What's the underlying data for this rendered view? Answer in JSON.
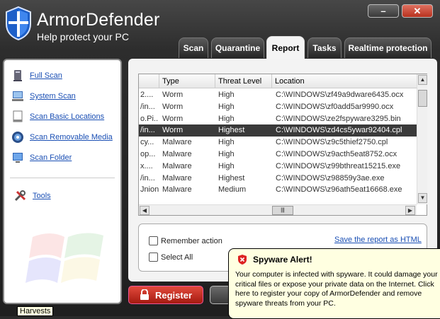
{
  "app": {
    "title": "ArmorDefender",
    "subtitle": "Help protect your PC",
    "minimize_label": "–",
    "close_label": "✕"
  },
  "tabs": [
    {
      "label": "Scan",
      "active": false
    },
    {
      "label": "Quarantine",
      "active": false
    },
    {
      "label": "Report",
      "active": true
    },
    {
      "label": "Tasks",
      "active": false
    },
    {
      "label": "Realtime protection",
      "active": false
    }
  ],
  "sidebar": {
    "items": [
      {
        "label": "Full Scan",
        "icon": "computer-icon"
      },
      {
        "label": "System Scan",
        "icon": "system-icon"
      },
      {
        "label": "Scan Basic Locations",
        "icon": "document-icon"
      },
      {
        "label": "Scan Removable Media",
        "icon": "disc-icon"
      },
      {
        "label": "Scan Folder",
        "icon": "monitor-icon"
      }
    ],
    "tools_label": "Tools"
  },
  "report": {
    "columns": [
      "Type",
      "Threat Level",
      "Location"
    ],
    "rows": [
      {
        "name": "2....",
        "type": "Worm",
        "level": "High",
        "location": "C:\\WINDOWS\\zf49a9dware6435.ocx",
        "selected": false
      },
      {
        "name": "/in...",
        "type": "Worm",
        "level": "High",
        "location": "C:\\WINDOWS\\zf0add5ar9990.ocx",
        "selected": false
      },
      {
        "name": "o.Pi...",
        "type": "Worm",
        "level": "High",
        "location": "C:\\WINDOWS\\ze2fspyware3295.bin",
        "selected": false
      },
      {
        "name": "/in...",
        "type": "Worm",
        "level": "Highest",
        "location": "C:\\WINDOWS\\zd4cs5ywar92404.cpl",
        "selected": true
      },
      {
        "name": "cy...",
        "type": "Malware",
        "level": "High",
        "location": "C:\\WINDOWS\\z9c5thief2750.cpl",
        "selected": false
      },
      {
        "name": "op...",
        "type": "Malware",
        "level": "High",
        "location": "C:\\WINDOWS\\z9acth5eat8752.ocx",
        "selected": false
      },
      {
        "name": "x....",
        "type": "Malware",
        "level": "High",
        "location": "C:\\WINDOWS\\z99bthreat15215.exe",
        "selected": false
      },
      {
        "name": "/in...",
        "type": "Malware",
        "level": "Highest",
        "location": "C:\\WINDOWS\\z98859y3ae.exe",
        "selected": false
      },
      {
        "name": "Jnion",
        "type": "Malware",
        "level": "Medium",
        "location": "C:\\WINDOWS\\z96ath5eat16668.exe",
        "selected": false
      }
    ]
  },
  "options": {
    "remember_label": "Remember action",
    "select_all_label": "Select All",
    "save_link": "Save the report as HTML"
  },
  "register_label": "Register",
  "alert": {
    "title": "Spyware Alert!",
    "body": "Your computer is infected with spyware. It could damage your critical files or expose your private data on the Internet. Click here to register your copy of ArmorDefender and remove spyware threats from your PC."
  },
  "tooltip": "Harvests",
  "colors": {
    "accent_blue": "#1a4fb4",
    "register_red": "#c4281b",
    "selected_row": "#3a3a3a",
    "balloon_bg": "#ffffe1"
  }
}
